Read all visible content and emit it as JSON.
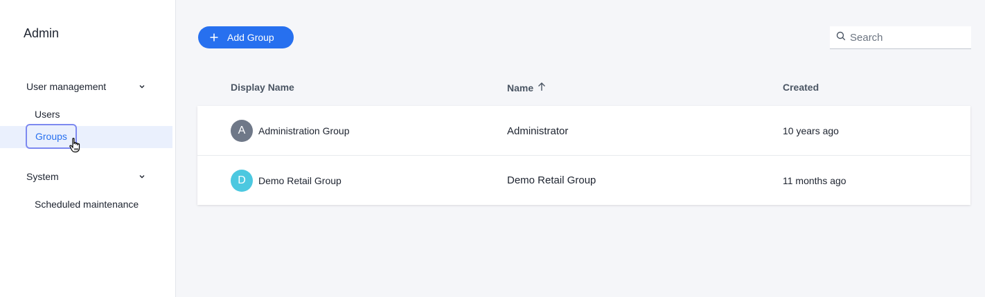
{
  "sidebar": {
    "title": "Admin",
    "sections": [
      {
        "label": "User management",
        "items": [
          "Users",
          "Groups"
        ]
      },
      {
        "label": "System",
        "items": [
          "Scheduled maintenance"
        ]
      }
    ],
    "active_item": "Groups"
  },
  "toolbar": {
    "add_label": "Add Group",
    "search_placeholder": "Search"
  },
  "table": {
    "columns": [
      "Display Name",
      "Name",
      "Created"
    ],
    "sort_column": "Name",
    "sort_direction": "ascending",
    "rows": [
      {
        "initial": "A",
        "avatar_color": "#6f7888",
        "display_name": "Administration Group",
        "name": "Administrator",
        "created": "10 years ago"
      },
      {
        "initial": "D",
        "avatar_color": "#4cc8e0",
        "display_name": "Demo Retail Group",
        "name": "Demo Retail Group",
        "created": "11 months ago"
      }
    ]
  },
  "colors": {
    "accent": "#2770ef",
    "active_bg": "#eaf0fd",
    "focus_ring": "#7d89f0"
  }
}
